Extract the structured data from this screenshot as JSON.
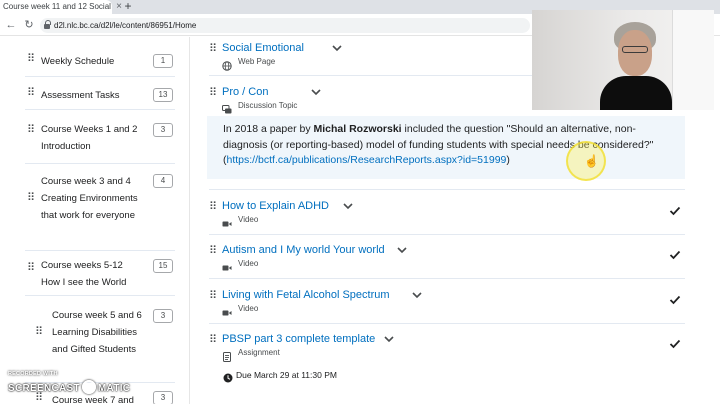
{
  "browser": {
    "tab_title": "Course week 11 and 12 Social Em",
    "tab_close": "×",
    "new_tab": "+",
    "url": "d2l.nlc.bc.ca/d2l/le/content/86951/Home"
  },
  "sidebar": {
    "items": [
      {
        "label": "Weekly Schedule",
        "count": "1"
      },
      {
        "label": "Assessment Tasks",
        "count": "13"
      },
      {
        "label": "Course Weeks 1 and 2 Introduction",
        "count": "3"
      },
      {
        "label": "Course week 3 and 4 Creating Environments that work for everyone",
        "count": "4"
      },
      {
        "label": "Course weeks 5-12 How I see the World",
        "count": "15"
      },
      {
        "label": "Course week 5 and 6 Learning Disabilities and Gifted Students",
        "count": "3"
      },
      {
        "label": "Course week 7 and",
        "count": "3"
      }
    ]
  },
  "topics": [
    {
      "title": "Social Emotional",
      "type": "Web Page",
      "checked": false
    },
    {
      "title": "Pro / Con",
      "type": "Discussion Topic",
      "checked": false
    },
    {
      "title": "How to Explain ADHD",
      "type": "Video",
      "checked": true
    },
    {
      "title": "Autism and I My world Your world",
      "type": "Video",
      "checked": true
    },
    {
      "title": "Living with Fetal Alcohol Spectrum",
      "type": "Video",
      "checked": true
    },
    {
      "title": "PBSP part 3 complete template",
      "type": "Assignment",
      "checked": true
    }
  ],
  "description": {
    "prefix": "In 2018 a paper by ",
    "author": "Michal Rozworski",
    "middle": " included  the question \"Should an alternative, non-diagnosis (or reporting-based) model of funding students with special needs be considered?\"(",
    "link": "https://bctf.ca/publications/ResearchReports.aspx?id=51999",
    "suffix": ")"
  },
  "due": "Due March 29 at 11:30 PM",
  "watermark": {
    "small": "RECORDED WITH",
    "left": "SCREENCAST",
    "right": "MATIC"
  },
  "colors": {
    "link": "#006fbf",
    "check": "#202122",
    "description_bg": "#f0f6fb"
  }
}
